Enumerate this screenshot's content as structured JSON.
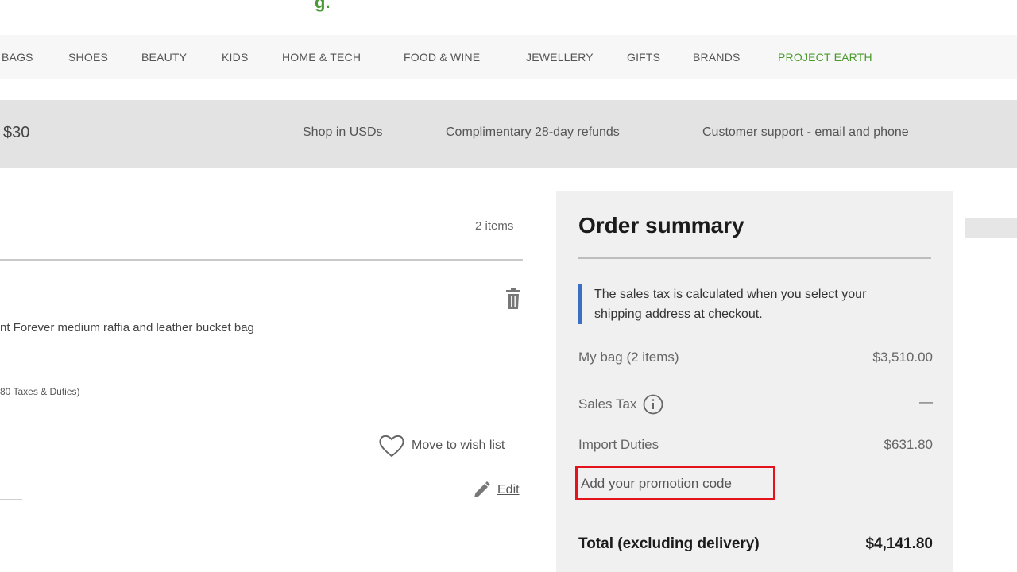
{
  "header": {
    "logo_fragment": "g."
  },
  "nav": {
    "items": [
      {
        "label": "BAGS"
      },
      {
        "label": "SHOES"
      },
      {
        "label": "BEAUTY"
      },
      {
        "label": "KIDS"
      },
      {
        "label": "HOME & TECH"
      },
      {
        "label": "FOOD & WINE"
      },
      {
        "label": "JEWELLERY"
      },
      {
        "label": "GIFTS"
      },
      {
        "label": "BRANDS"
      },
      {
        "label": "PROJECT EARTH"
      }
    ],
    "highlight_color": "#4a9a2c"
  },
  "promo_bar": {
    "left_text": "$30",
    "items": [
      {
        "label": "Shop in USDs"
      },
      {
        "label": "Complimentary 28-day refunds"
      },
      {
        "label": "Customer support - email and phone"
      }
    ]
  },
  "bag": {
    "count_label": "2 items",
    "item": {
      "name": "nt Forever medium raffia and leather bucket bag",
      "tax_note": "80 Taxes & Duties)",
      "wishlist_label": "Move to wish list",
      "edit_label": "Edit",
      "icons": {
        "delete": "trash-icon",
        "wishlist": "heart-icon",
        "edit": "pencil-icon"
      }
    }
  },
  "order_summary": {
    "title": "Order summary",
    "tax_notice": "The sales tax is calculated when you select your shipping address at checkout.",
    "accent_color": "#3a6fc4",
    "rows": [
      {
        "label": "My bag (2 items)",
        "value": "$3,510.00"
      },
      {
        "label": "Sales Tax",
        "value": "—"
      },
      {
        "label": "Import Duties",
        "value": "$631.80"
      }
    ],
    "promo_link": "Add your promotion code",
    "highlight_color": "#e3121b",
    "total": {
      "label": "Total (excluding delivery)",
      "value": "$4,141.80"
    }
  }
}
